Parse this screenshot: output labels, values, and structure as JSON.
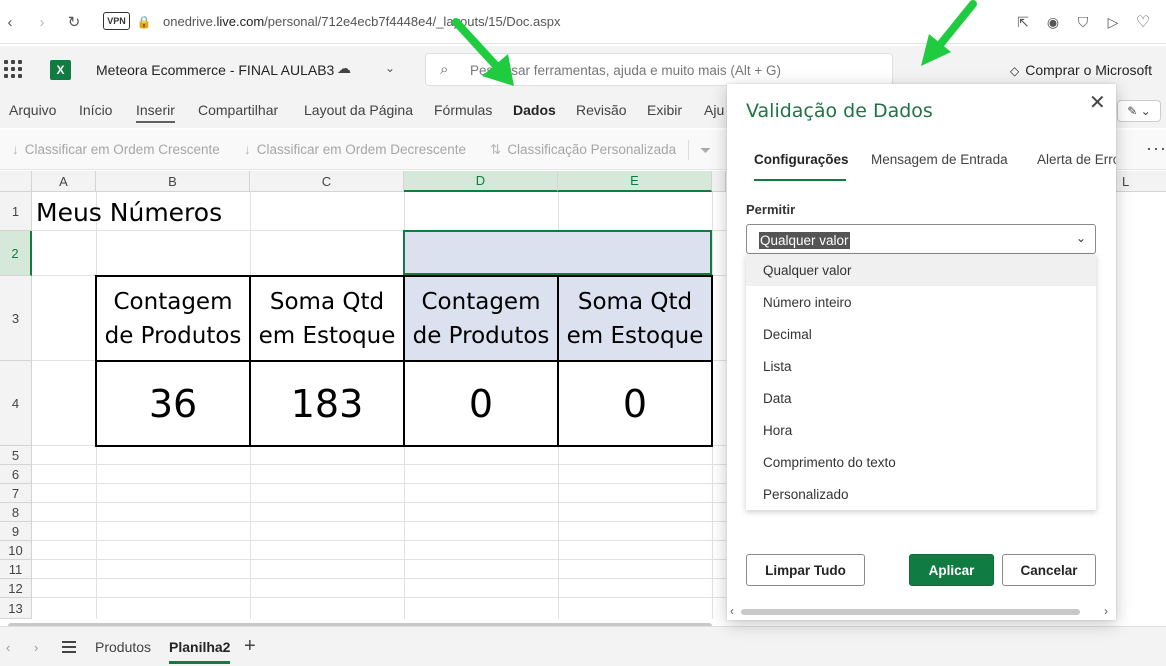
{
  "browser": {
    "url_prefix": "onedrive.",
    "url_domain": "live.com",
    "url_path": "/personal/712e4ecb7f4448e4/_layouts/15/Doc.aspx",
    "vpn_label": "VPN"
  },
  "app": {
    "logo_letter": "X",
    "document_title": "Meteora Ecommerce - FINAL AULAB3",
    "search_placeholder": "Pesquisar ferramentas, ajuda e muito mais (Alt + G)",
    "buy_label": "Comprar o Microsoft"
  },
  "menu": [
    "Arquivo",
    "Início",
    "Inserir",
    "Compartilhar",
    "Layout da Página",
    "Fórmulas",
    "Dados",
    "Revisão",
    "Exibir",
    "Aju"
  ],
  "toolbar": {
    "sort_asc": "Classificar em Ordem Crescente",
    "sort_desc": "Classificar em Ordem Decrescente",
    "custom_sort": "Classificação Personalizada",
    "more": "···"
  },
  "sheet": {
    "columns": [
      "A",
      "B",
      "C",
      "D",
      "E",
      "L"
    ],
    "rows": [
      "1",
      "2",
      "3",
      "4",
      "5",
      "6",
      "7",
      "8",
      "9",
      "10",
      "11",
      "12",
      "13"
    ],
    "a1": "Meus Números",
    "headers": {
      "b": "Contagem de Produtos",
      "c": "Soma Qtd em Estoque",
      "d": "Contagem de Produtos",
      "e": "Soma Qtd em Estoque"
    },
    "values": {
      "b": "36",
      "c": "183",
      "d": "0",
      "e": "0"
    }
  },
  "sheet_tabs": [
    "Produtos",
    "Planilha2"
  ],
  "panel": {
    "title": "Validação de Dados",
    "tabs": [
      "Configurações",
      "Mensagem de Entrada",
      "Alerta de Erro"
    ],
    "allow_label": "Permitir",
    "selected_value": "Qualquer valor",
    "options": [
      "Qualquer valor",
      "Número inteiro",
      "Decimal",
      "Lista",
      "Data",
      "Hora",
      "Comprimento do texto",
      "Personalizado"
    ],
    "buttons": {
      "clear": "Limpar Tudo",
      "apply": "Aplicar",
      "cancel": "Cancelar"
    }
  },
  "colors": {
    "excel_green": "#107c41",
    "annotation_arrow": "#1fcc3f",
    "selection_fill": "#dce1f0"
  }
}
